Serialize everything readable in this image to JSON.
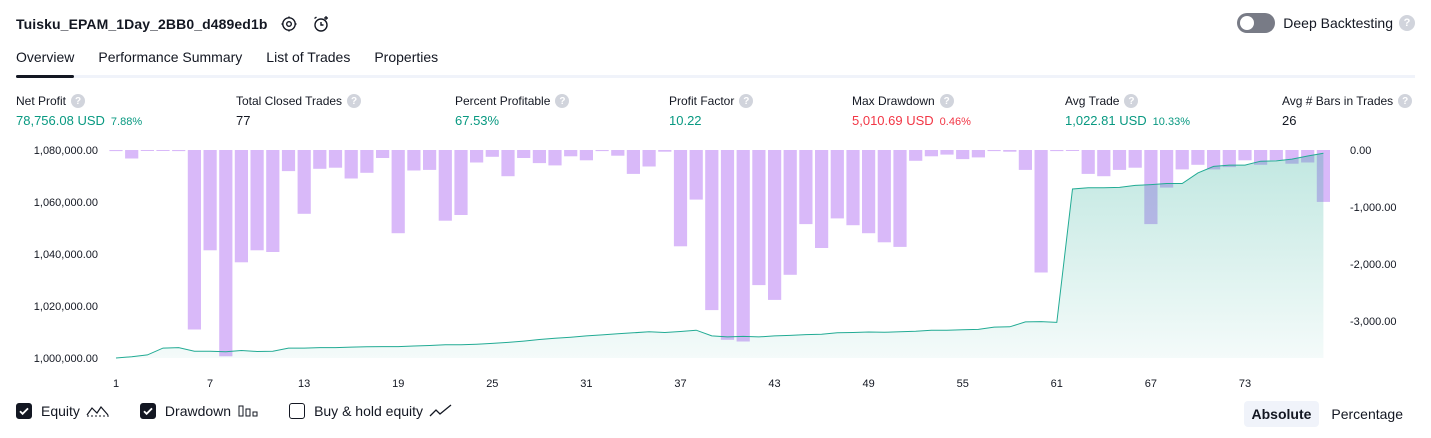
{
  "header": {
    "strategy_name": "Tuisku_EPAM_1Day_2BB0_d489ed1b",
    "deep_backtesting_label": "Deep Backtesting",
    "deep_backtesting_enabled": false
  },
  "tabs": [
    {
      "label": "Overview",
      "active": true
    },
    {
      "label": "Performance Summary",
      "active": false
    },
    {
      "label": "List of Trades",
      "active": false
    },
    {
      "label": "Properties",
      "active": false
    }
  ],
  "metrics": [
    {
      "label": "Net Profit",
      "value": "78,756.08 USD",
      "sub": "7.88%",
      "tone": "pos"
    },
    {
      "label": "Total Closed Trades",
      "value": "77",
      "sub": "",
      "tone": "dark"
    },
    {
      "label": "Percent Profitable",
      "value": "67.53%",
      "sub": "",
      "tone": "pos"
    },
    {
      "label": "Profit Factor",
      "value": "10.22",
      "sub": "",
      "tone": "pos"
    },
    {
      "label": "Max Drawdown",
      "value": "5,010.69 USD",
      "sub": "0.46%",
      "tone": "neg"
    },
    {
      "label": "Avg Trade",
      "value": "1,022.81 USD",
      "sub": "10.33%",
      "tone": "pos"
    },
    {
      "label": "Avg # Bars in Trades",
      "value": "26",
      "sub": "",
      "tone": "dark"
    }
  ],
  "chart_data": {
    "type": "bar+area",
    "x": [
      1,
      2,
      3,
      4,
      5,
      6,
      7,
      8,
      9,
      10,
      11,
      12,
      13,
      14,
      15,
      16,
      17,
      18,
      19,
      20,
      21,
      22,
      23,
      24,
      25,
      26,
      27,
      28,
      29,
      30,
      31,
      32,
      33,
      34,
      35,
      36,
      37,
      38,
      39,
      40,
      41,
      42,
      43,
      44,
      45,
      46,
      47,
      48,
      49,
      50,
      51,
      52,
      53,
      54,
      55,
      56,
      57,
      58,
      59,
      60,
      61,
      62,
      63,
      64,
      65,
      66,
      67,
      68,
      69,
      70,
      71,
      72,
      73,
      74,
      75,
      76,
      77,
      78
    ],
    "x_ticks": [
      1,
      7,
      13,
      19,
      25,
      31,
      37,
      43,
      49,
      55,
      61,
      67,
      73
    ],
    "left_axis": {
      "ylim": [
        1000000,
        1080000
      ],
      "ticks": [
        "1,000,000.00",
        "1,020,000.00",
        "1,040,000.00",
        "1,060,000.00",
        "1,080,000.00"
      ]
    },
    "right_axis": {
      "ylim": [
        -3650,
        0
      ],
      "ticks": [
        "0.00",
        "-1,000.00",
        "-2,000.00",
        "-3,000.00"
      ]
    },
    "series": [
      {
        "name": "Equity",
        "axis": "left",
        "color": "#22ab94",
        "values": [
          1000000,
          1000500,
          1001200,
          1003800,
          1004000,
          1002600,
          1002600,
          1002400,
          1002900,
          1002500,
          1002600,
          1003800,
          1003800,
          1004000,
          1004000,
          1004200,
          1004300,
          1004400,
          1004400,
          1004600,
          1004800,
          1005100,
          1005100,
          1005300,
          1005600,
          1006000,
          1006500,
          1007100,
          1007600,
          1008000,
          1008500,
          1008900,
          1009300,
          1009700,
          1010100,
          1009800,
          1010200,
          1010700,
          1008500,
          1008100,
          1008300,
          1008100,
          1008500,
          1008700,
          1009000,
          1009100,
          1009700,
          1009800,
          1010000,
          1009900,
          1010100,
          1010300,
          1010700,
          1010700,
          1010900,
          1011000,
          1011900,
          1012000,
          1013900,
          1014000,
          1013700,
          1065000,
          1065500,
          1065500,
          1065600,
          1066400,
          1066700,
          1067100,
          1067100,
          1071200,
          1073700,
          1074200,
          1074200,
          1075700,
          1075800,
          1076500,
          1077700,
          1078756
        ]
      },
      {
        "name": "Drawdown",
        "axis": "right",
        "color": "#cfa7f7",
        "values": [
          -20,
          -150,
          0,
          -10,
          -20,
          -3150,
          -1760,
          -3620,
          -1970,
          -1760,
          -1790,
          -370,
          -1120,
          -330,
          -310,
          -500,
          -400,
          -140,
          -1460,
          -360,
          -350,
          -1240,
          -1140,
          -220,
          -120,
          -460,
          -140,
          -230,
          -270,
          -110,
          -180,
          -20,
          -100,
          -420,
          -290,
          -30,
          -1690,
          -870,
          -2810,
          -3330,
          -3360,
          -2370,
          -2630,
          -2190,
          -1300,
          -1720,
          -1200,
          -1320,
          -1460,
          -1620,
          -1700,
          -190,
          -110,
          -80,
          -160,
          -130,
          -20,
          -30,
          -350,
          -2150,
          -20,
          0,
          -420,
          -460,
          -350,
          -310,
          -1300,
          -660,
          -340,
          -260,
          -340,
          -300,
          -180,
          -260,
          -180,
          -240,
          -220,
          -910
        ]
      }
    ],
    "legend": [
      "Equity",
      "Drawdown",
      "Buy & hold equity"
    ]
  },
  "legend": {
    "equity_label": "Equity",
    "equity_checked": true,
    "drawdown_label": "Drawdown",
    "drawdown_checked": true,
    "bh_label": "Buy & hold equity",
    "bh_checked": false
  },
  "mode": {
    "absolute_label": "Absolute",
    "percentage_label": "Percentage",
    "active": "Absolute"
  },
  "icons": {
    "settings": "gear-icon",
    "alert": "alarm-clock-plus-icon",
    "help": "question-icon",
    "check": "checkmark-icon"
  }
}
